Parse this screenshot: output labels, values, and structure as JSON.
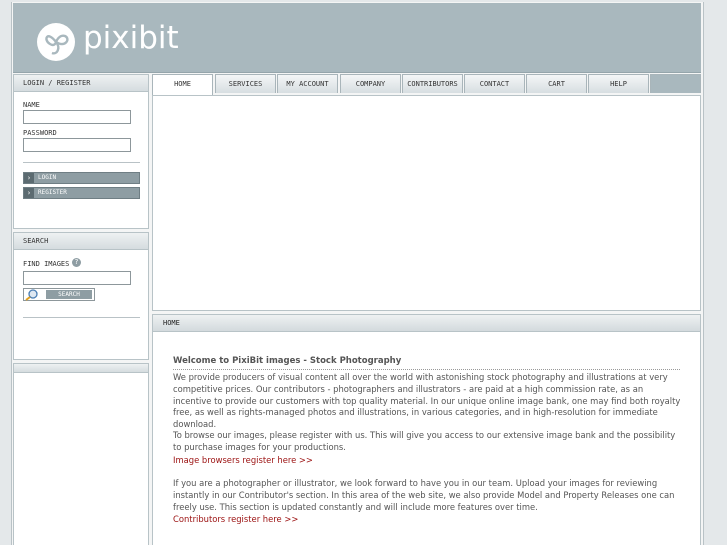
{
  "logo": {
    "text": "pixibit"
  },
  "tabs": [
    {
      "label": "HOME",
      "active": true
    },
    {
      "label": "SERVICES"
    },
    {
      "label": "MY ACCOUNT"
    },
    {
      "label": "COMPANY"
    },
    {
      "label": "CONTRIBUTORS"
    },
    {
      "label": "CONTACT"
    },
    {
      "label": "CART"
    },
    {
      "label": "HELP"
    }
  ],
  "login": {
    "title": "LOGIN / REGISTER",
    "name_label": "NAME",
    "password_label": "PASSWORD",
    "login_button": "LOGIN",
    "register_button": "REGISTER"
  },
  "search": {
    "title": "SEARCH",
    "find_label": "FIND IMAGES",
    "button": "SEARCH"
  },
  "breadcrumb": "HOME",
  "main": {
    "welcome": "Welcome to PixiBit images - Stock Photography",
    "para1": "We provide producers of visual content all over the world with astonishing stock photography and illustrations at very competitive prices. Our contributors - photographers and illustrators - are paid at a high commission rate, as an incentive to provide our customers with top quality material. In our unique online image bank, one may find both royalty free, as well as rights-managed photos and illustrations, in various categories, and in high-resolution for immediate download.",
    "para2": "To browse our images, please register with us. This will give you access to our extensive image bank and the possibility to purchase images for your productions.",
    "link1": "Image browsers register here >>",
    "para3": "If you are a photographer or illustrator, we look forward to have you in our team. Upload your images for reviewing instantly in our Contributor's section. In this area of the web site, we also provide Model and Property Releases one can freely use. This section is updated constantly and will include more features over time.",
    "link2": "Contributors register here >>"
  }
}
